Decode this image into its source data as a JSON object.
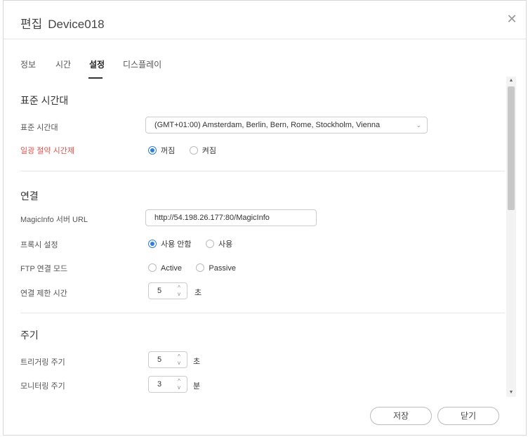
{
  "title": {
    "prefix": "편집",
    "device": "Device018"
  },
  "tabs": [
    {
      "label": "정보"
    },
    {
      "label": "시간"
    },
    {
      "label": "설정"
    },
    {
      "label": "디스플레이"
    }
  ],
  "active_tab": "설정",
  "sections": {
    "timezone": {
      "title": "표준 시간대",
      "timezone_label": "표준 시간대",
      "timezone_value": "(GMT+01:00) Amsterdam, Berlin, Bern, Rome, Stockholm, Vienna",
      "dst_label": "일광 절약 시간제",
      "dst_off": "꺼짐",
      "dst_on": "켜짐",
      "dst_selected": "꺼짐"
    },
    "connection": {
      "title": "연결",
      "url_label": "MagicInfo 서버 URL",
      "url_value": "http://54.198.26.177:80/MagicInfo",
      "proxy_label": "프록시 설정",
      "proxy_off": "사용 안함",
      "proxy_on": "사용",
      "proxy_selected": "사용 안함",
      "ftp_label": "FTP 연결 모드",
      "ftp_active": "Active",
      "ftp_passive": "Passive",
      "timeout_label": "연결 제한 시간",
      "timeout_value": "5",
      "timeout_unit": "초"
    },
    "period": {
      "title": "주기",
      "trigger_label": "트리거링 주기",
      "trigger_value": "5",
      "trigger_unit": "초",
      "monitor_label": "모니터링 주기",
      "monitor_value": "3",
      "monitor_unit": "분"
    }
  },
  "footer": {
    "save": "저장",
    "close": "닫기"
  },
  "colors": {
    "accent": "#2f7fd8",
    "warning_label": "#d9534f"
  },
  "icons": {
    "close": "close-icon",
    "dropdown": "chevron-down-icon",
    "stepper": "stepper-arrows-icon"
  }
}
